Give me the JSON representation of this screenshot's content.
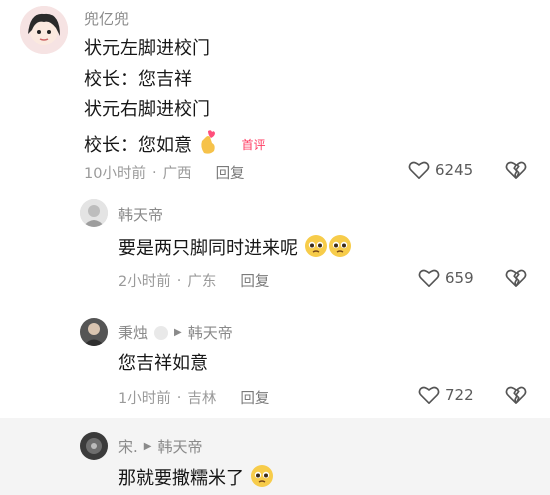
{
  "comments": [
    {
      "author": "兜亿兜",
      "lines": [
        "状元左脚进校门",
        "校长：您吉祥",
        "状元右脚进校门",
        "校长：您如意"
      ],
      "badge": "首评",
      "time": "10小时前",
      "location": "广西",
      "reply_label": "回复",
      "likes": "6245"
    }
  ],
  "replies": [
    {
      "author": "韩天帝",
      "text": "要是两只脚同时进来呢",
      "time": "2小时前",
      "location": "广东",
      "reply_label": "回复",
      "likes": "659"
    },
    {
      "author": "秉烛",
      "reply_to": "韩天帝",
      "text": "您吉祥如意",
      "time": "1小时前",
      "location": "吉林",
      "reply_label": "回复",
      "likes": "722"
    },
    {
      "author": "宋.",
      "reply_to": "韩天帝",
      "text": "那就要撒糯米了"
    }
  ],
  "colors": {
    "badge": "#ff3d63",
    "meta": "#9a9a9a",
    "text": "#161616"
  }
}
